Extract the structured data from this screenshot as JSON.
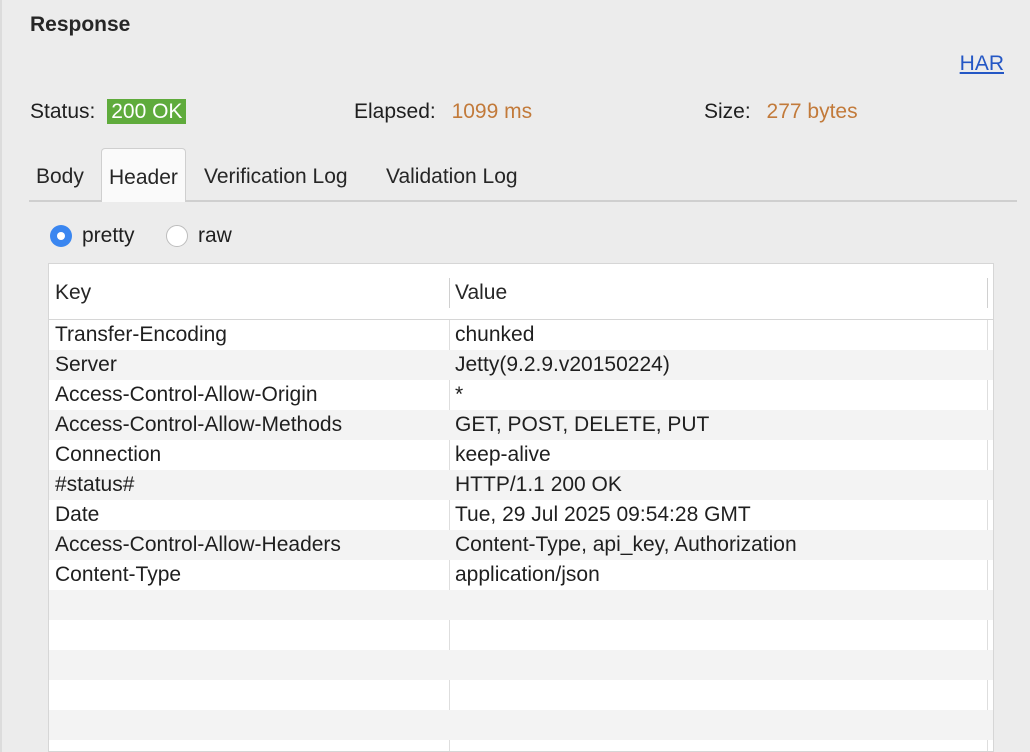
{
  "panel": {
    "title": "Response",
    "har_link": "HAR"
  },
  "status": {
    "status_label": "Status:",
    "status_value": "200 OK",
    "elapsed_label": "Elapsed:",
    "elapsed_value": "1099 ms",
    "size_label": "Size:",
    "size_value": "277 bytes"
  },
  "colors": {
    "status_ok": "#5fab3c",
    "metric": "#c27a3a",
    "link": "#2457c5",
    "radio_accent": "#3a86f0"
  },
  "tabs": [
    {
      "label": "Body",
      "active": false
    },
    {
      "label": "Header",
      "active": true
    },
    {
      "label": "Verification Log",
      "active": false
    },
    {
      "label": "Validation Log",
      "active": false
    }
  ],
  "format": {
    "pretty_label": "pretty",
    "raw_label": "raw",
    "selected": "pretty"
  },
  "table": {
    "headers": {
      "key": "Key",
      "value": "Value"
    },
    "rows": [
      {
        "key": "Transfer-Encoding",
        "value": "chunked"
      },
      {
        "key": "Server",
        "value": "Jetty(9.2.9.v20150224)"
      },
      {
        "key": "Access-Control-Allow-Origin",
        "value": "*"
      },
      {
        "key": "Access-Control-Allow-Methods",
        "value": "GET, POST, DELETE, PUT"
      },
      {
        "key": "Connection",
        "value": "keep-alive"
      },
      {
        "key": "#status#",
        "value": "HTTP/1.1 200 OK"
      },
      {
        "key": "Date",
        "value": "Tue, 29 Jul 2025 09:54:28 GMT"
      },
      {
        "key": "Access-Control-Allow-Headers",
        "value": "Content-Type, api_key, Authorization"
      },
      {
        "key": "Content-Type",
        "value": "application/json"
      }
    ]
  }
}
